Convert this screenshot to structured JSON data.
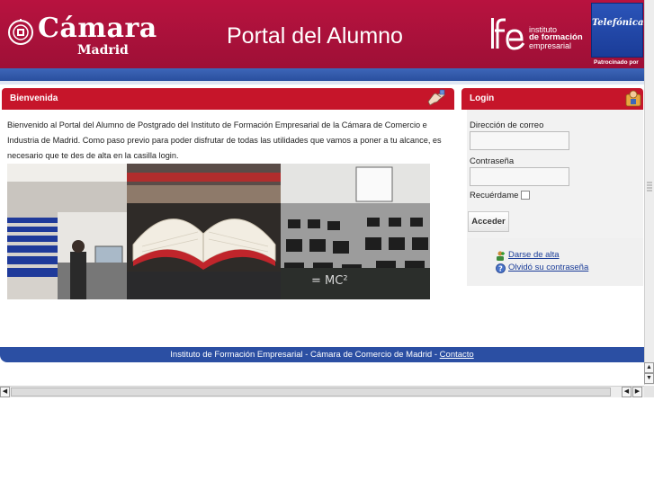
{
  "header": {
    "camara_word": "Cámara",
    "camara_city": "Madrid",
    "portal_title": "Portal del Alumno",
    "ife_line1": "instituto",
    "ife_line2": "de formación",
    "ife_line3": "empresarial",
    "sponsor_logo": "Telefónica",
    "sponsor_caption": "Patrocinado por"
  },
  "welcome": {
    "title": "Bienvenida",
    "text": "Bienvenido al Portal del Alumno de Postgrado del Instituto de Formación Empresarial de la Cámara de Comercio e Industria de Madrid. Como paso previo para poder disfrutar de todas las utilidades que vamos a poner a tu alcance, es necesario que te des de alta en la casilla login.",
    "photo_caption": "= MC²"
  },
  "login": {
    "title": "Login",
    "email_label": "Dirección de correo",
    "email_value": "",
    "password_label": "Contraseña",
    "password_value": "",
    "remember_label": "Recuérdame",
    "remember_checked": false,
    "submit_label": "Acceder",
    "link_register": "Darse de alta",
    "link_forgot": "Olvidó su contraseña"
  },
  "footer": {
    "text": "Instituto de Formación Empresarial - Cámara de Comercio de Madrid - ",
    "contact_link": "Contacto"
  },
  "colors": {
    "brand_red": "#c6152a",
    "header_red": "#b8123f",
    "brand_blue": "#2b4fa3"
  },
  "icons": [
    "camara-seal-icon",
    "ife-logo-icon",
    "welcome-hand-icon",
    "login-person-icon",
    "add-user-icon",
    "help-icon"
  ]
}
